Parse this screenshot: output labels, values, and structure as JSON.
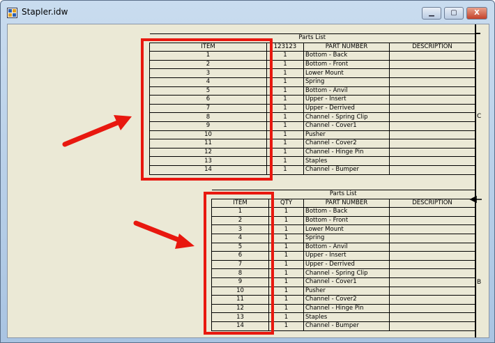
{
  "window": {
    "title": "Stapler.idw",
    "minimize": "▁",
    "maximize": "▢",
    "close": "X"
  },
  "zones": {
    "c": "C",
    "b": "B"
  },
  "colors": {
    "annotation": "#e8180f",
    "paper": "#ebe9d6"
  },
  "tables": [
    {
      "caption": "Parts List",
      "headers": [
        "ITEM",
        "123123",
        "PART NUMBER",
        "DESCRIPTION"
      ],
      "rows": [
        [
          "1",
          "1",
          "Bottom - Back",
          ""
        ],
        [
          "2",
          "1",
          "Bottom - Front",
          ""
        ],
        [
          "3",
          "1",
          "Lower Mount",
          ""
        ],
        [
          "4",
          "1",
          "Spring",
          ""
        ],
        [
          "5",
          "1",
          "Bottom - Anvil",
          ""
        ],
        [
          "6",
          "1",
          "Upper - Insert",
          ""
        ],
        [
          "7",
          "1",
          "Upper - Derrived",
          ""
        ],
        [
          "8",
          "1",
          "Channel - Spring Clip",
          ""
        ],
        [
          "9",
          "1",
          "Channel - Cover1",
          ""
        ],
        [
          "10",
          "1",
          "Pusher",
          ""
        ],
        [
          "11",
          "1",
          "Channel - Cover2",
          ""
        ],
        [
          "12",
          "1",
          "Channel - Hinge Pin",
          ""
        ],
        [
          "13",
          "1",
          "Staples",
          ""
        ],
        [
          "14",
          "1",
          "Channel - Bumper",
          ""
        ]
      ]
    },
    {
      "caption": "Parts List",
      "headers": [
        "ITEM",
        "QTY",
        "PART NUMBER",
        "DESCRIPTION"
      ],
      "rows": [
        [
          "1",
          "1",
          "Bottom - Back",
          ""
        ],
        [
          "2",
          "1",
          "Bottom - Front",
          ""
        ],
        [
          "3",
          "1",
          "Lower Mount",
          ""
        ],
        [
          "4",
          "1",
          "Spring",
          ""
        ],
        [
          "5",
          "1",
          "Bottom - Anvil",
          ""
        ],
        [
          "6",
          "1",
          "Upper - Insert",
          ""
        ],
        [
          "7",
          "1",
          "Upper - Derrived",
          ""
        ],
        [
          "8",
          "1",
          "Channel - Spring Clip",
          ""
        ],
        [
          "9",
          "1",
          "Channel - Cover1",
          ""
        ],
        [
          "10",
          "1",
          "Pusher",
          ""
        ],
        [
          "11",
          "1",
          "Channel - Cover2",
          ""
        ],
        [
          "12",
          "1",
          "Channel - Hinge Pin",
          ""
        ],
        [
          "13",
          "1",
          "Staples",
          ""
        ],
        [
          "14",
          "1",
          "Channel - Bumper",
          ""
        ]
      ]
    }
  ]
}
